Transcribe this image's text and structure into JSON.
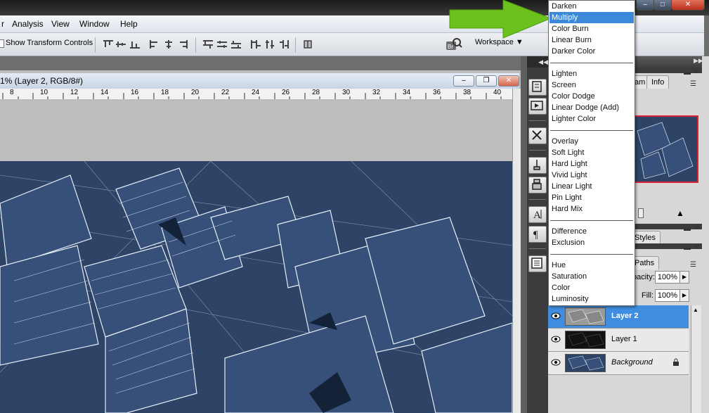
{
  "menubar": {
    "items": [
      "r",
      "Analysis",
      "View",
      "Window",
      "Help"
    ]
  },
  "options": {
    "show_transform_controls": "Show Transform Controls",
    "workspace_label": "Workspace"
  },
  "document": {
    "title": "1% (Layer 2, RGB/8#)",
    "ruler_ticks": [
      "8",
      "10",
      "12",
      "14",
      "16",
      "18",
      "20",
      "22",
      "24",
      "26",
      "28",
      "30",
      "32",
      "34",
      "36",
      "38",
      "40"
    ]
  },
  "panels": {
    "tabs_top": [
      "am",
      "Info"
    ],
    "tabs_mid": [
      "Styles"
    ],
    "tabs_layers": [
      "Paths"
    ],
    "opacity_label": "pacity:",
    "opacity_value": "100%",
    "fill_label": "Fill:",
    "fill_value": "100%"
  },
  "layers": [
    {
      "name": "Layer 2",
      "active": true
    },
    {
      "name": "Layer 1",
      "active": false
    },
    {
      "name": "Background",
      "active": false,
      "locked": true
    }
  ],
  "blend_modes": {
    "selected": "Multiply",
    "groups": [
      [
        "Darken",
        "Multiply",
        "Color Burn",
        "Linear Burn",
        "Darker Color"
      ],
      [
        "Lighten",
        "Screen",
        "Color Dodge",
        "Linear Dodge (Add)",
        "Lighter Color"
      ],
      [
        "Overlay",
        "Soft Light",
        "Hard Light",
        "Vivid Light",
        "Linear Light",
        "Pin Light",
        "Hard Mix"
      ],
      [
        "Difference",
        "Exclusion"
      ],
      [
        "Hue",
        "Saturation",
        "Color",
        "Luminosity"
      ]
    ]
  },
  "colors": {
    "accent": "#3b8ad9",
    "arrow": "#6cc11d",
    "artwork": "#2d4466"
  }
}
